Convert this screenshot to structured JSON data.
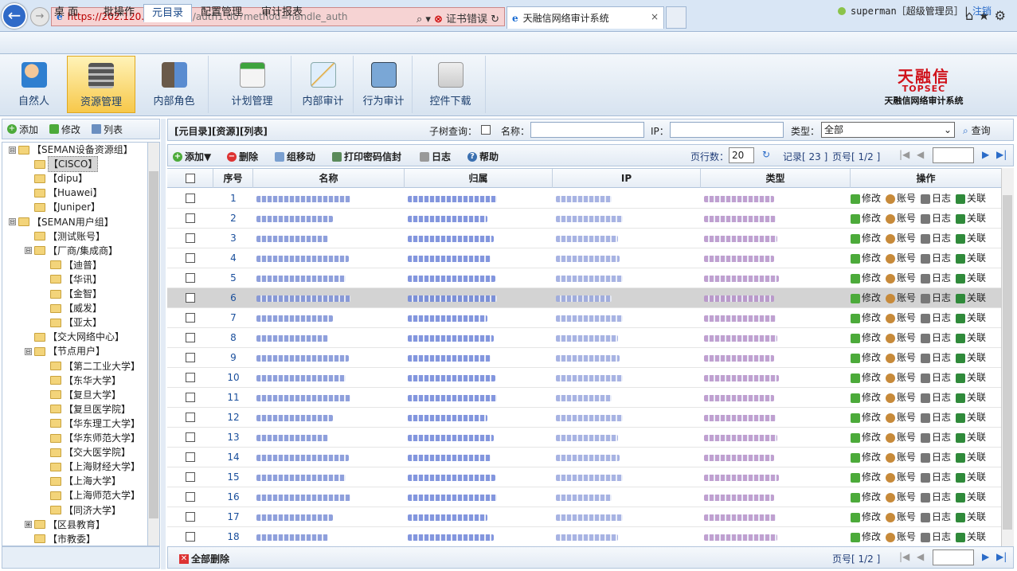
{
  "browser": {
    "url_host": "https://202.120.2.200",
    "url_path": "/aim/auth1.do?method=handle_auth",
    "cert_error": "证书错误",
    "tab_title": "天融信网络审计系统",
    "tab_close": "×"
  },
  "nav": {
    "tabs": [
      "桌 面",
      "批操作",
      "元目录",
      "配置管理",
      "审计报表"
    ],
    "active": "元目录",
    "user": "superman［超级管理员］|",
    "logout": "注销"
  },
  "toolbar": {
    "buttons": [
      "自然人",
      "资源管理",
      "内部角色",
      "计划管理",
      "内部审计",
      "行为审计",
      "控件下载"
    ],
    "active": "资源管理"
  },
  "logo": {
    "cn": "天融信",
    "brand": "TOPSEC",
    "sub": "天融信网络审计系统"
  },
  "left": {
    "add": "添加",
    "edit": "修改",
    "list": "列表",
    "tree": [
      {
        "label": "【SEMAN设备资源组】",
        "level": 0,
        "toggle": "⊟",
        "selected": false
      },
      {
        "label": "【CISCO】",
        "level": 1,
        "toggle": "",
        "selected": true
      },
      {
        "label": "【dipu】",
        "level": 1,
        "toggle": "",
        "selected": false
      },
      {
        "label": "【Huawei】",
        "level": 1,
        "toggle": "",
        "selected": false
      },
      {
        "label": "【Juniper】",
        "level": 1,
        "toggle": "",
        "selected": false
      },
      {
        "label": "【SEMAN用户组】",
        "level": 0,
        "toggle": "⊟",
        "selected": false
      },
      {
        "label": "【测试账号】",
        "level": 1,
        "toggle": "",
        "selected": false
      },
      {
        "label": "【厂商/集成商】",
        "level": 1,
        "toggle": "⊟",
        "selected": false
      },
      {
        "label": "【迪普】",
        "level": 2,
        "toggle": "",
        "selected": false
      },
      {
        "label": "【华讯】",
        "level": 2,
        "toggle": "",
        "selected": false
      },
      {
        "label": "【金智】",
        "level": 2,
        "toggle": "",
        "selected": false
      },
      {
        "label": "【威发】",
        "level": 2,
        "toggle": "",
        "selected": false
      },
      {
        "label": "【亚太】",
        "level": 2,
        "toggle": "",
        "selected": false
      },
      {
        "label": "【交大网络中心】",
        "level": 1,
        "toggle": "",
        "selected": false
      },
      {
        "label": "【节点用户】",
        "level": 1,
        "toggle": "⊟",
        "selected": false
      },
      {
        "label": "【第二工业大学】",
        "level": 2,
        "toggle": "",
        "selected": false
      },
      {
        "label": "【东华大学】",
        "level": 2,
        "toggle": "",
        "selected": false
      },
      {
        "label": "【复旦大学】",
        "level": 2,
        "toggle": "",
        "selected": false
      },
      {
        "label": "【复旦医学院】",
        "level": 2,
        "toggle": "",
        "selected": false
      },
      {
        "label": "【华东理工大学】",
        "level": 2,
        "toggle": "",
        "selected": false
      },
      {
        "label": "【华东师范大学】",
        "level": 2,
        "toggle": "",
        "selected": false
      },
      {
        "label": "【交大医学院】",
        "level": 2,
        "toggle": "",
        "selected": false
      },
      {
        "label": "【上海财经大学】",
        "level": 2,
        "toggle": "",
        "selected": false
      },
      {
        "label": "【上海大学】",
        "level": 2,
        "toggle": "",
        "selected": false
      },
      {
        "label": "【上海师范大学】",
        "level": 2,
        "toggle": "",
        "selected": false
      },
      {
        "label": "【同济大学】",
        "level": 2,
        "toggle": "",
        "selected": false
      },
      {
        "label": "【区县教育】",
        "level": 1,
        "toggle": "⊞",
        "selected": false
      },
      {
        "label": "【市教委】",
        "level": 1,
        "toggle": "",
        "selected": false
      }
    ]
  },
  "right": {
    "title": "[元目录][资源][列表]",
    "subtree_label": "子树查询：",
    "name_label": "名称：",
    "ip_label": "IP：",
    "type_label": "类型：",
    "type_value": "全部",
    "query": "查询",
    "actions": {
      "add": "添加▼",
      "delete": "删除",
      "move": "组移动",
      "print": "打印密码信封",
      "log": "日志",
      "help": "帮助"
    },
    "page_rows_label": "页行数：",
    "page_rows": "20",
    "records": "记录[ 23 ]",
    "page": "页号[ 1/2 ]",
    "page_bottom": "页号[ 1/2 ]",
    "delete_all": "全部删除"
  },
  "table": {
    "columns": [
      "序号",
      "名称",
      "归属",
      "IP",
      "类型",
      "操作"
    ],
    "ops": [
      "修改",
      "账号",
      "日志",
      "关联"
    ],
    "rows": [
      "1",
      "2",
      "3",
      "4",
      "5",
      "6",
      "7",
      "8",
      "9",
      "10",
      "11",
      "12",
      "13",
      "14",
      "15",
      "16",
      "17",
      "18"
    ],
    "highlight_row": "6"
  }
}
